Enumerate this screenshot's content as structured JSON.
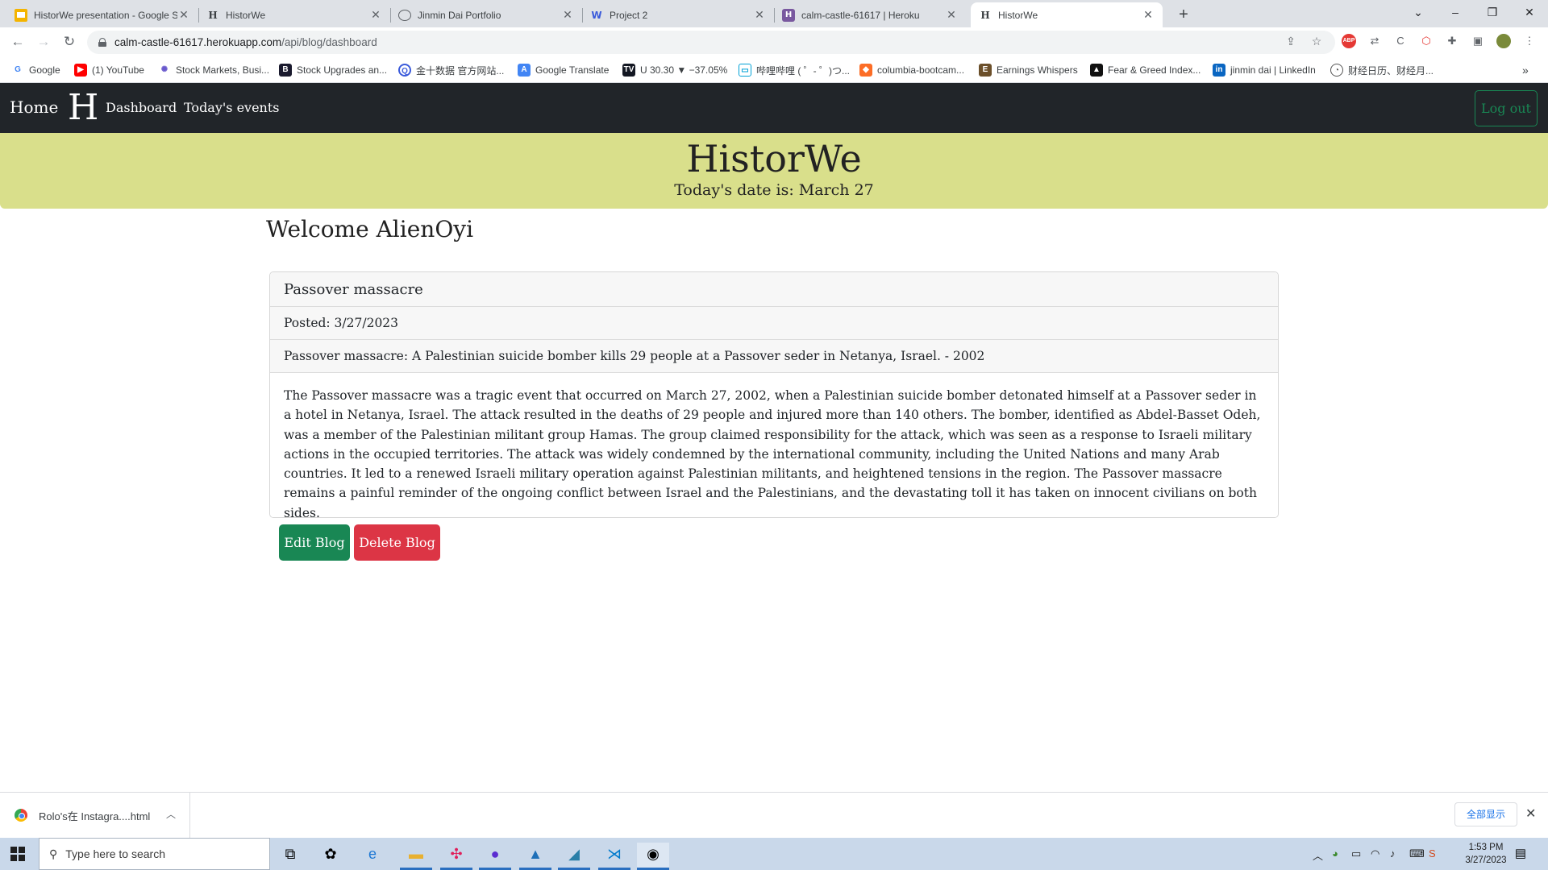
{
  "browser": {
    "tabs": [
      {
        "title": "HistorWe presentation - Google S",
        "icon": "slides-icon",
        "color": "#f4b400",
        "active": false
      },
      {
        "title": "HistorWe",
        "icon": "historwe-favicon",
        "active": false
      },
      {
        "title": "Jinmin Dai Portfolio",
        "icon": "globe-icon",
        "active": false
      },
      {
        "title": "Project 2",
        "icon": "project-icon",
        "active": false
      },
      {
        "title": "calm-castle-61617 | Heroku",
        "icon": "heroku-icon",
        "color": "#79589f",
        "active": false
      },
      {
        "title": "HistorWe",
        "icon": "historwe-favicon",
        "active": true
      }
    ],
    "url_host": "calm-castle-61617.herokuapp.com",
    "url_path": "/api/blog/dashboard",
    "bookmarks": [
      {
        "label": "Google",
        "icon": "google-icon"
      },
      {
        "label": "(1) YouTube",
        "icon": "youtube-icon"
      },
      {
        "label": "Stock Markets, Busi...",
        "icon": "nbc-icon"
      },
      {
        "label": "Stock Upgrades an...",
        "icon": "b-icon"
      },
      {
        "label": "金十数据 官方网站...",
        "icon": "jin10-icon"
      },
      {
        "label": "Google Translate",
        "icon": "translate-icon"
      },
      {
        "label": "U 30.30 ▼ −37.05%",
        "icon": "tradingview-icon"
      },
      {
        "label": "哔哩哔哩 ( ゜- ゜)つ...",
        "icon": "bilibili-icon"
      },
      {
        "label": "columbia-bootcam...",
        "icon": "gitlab-icon"
      },
      {
        "label": "Earnings Whispers",
        "icon": "earnings-icon"
      },
      {
        "label": "Fear & Greed Index...",
        "icon": "cnn-icon"
      },
      {
        "label": "jinmin dai | LinkedIn",
        "icon": "linkedin-icon"
      },
      {
        "label": "财经日历、财经月...",
        "icon": "calendar-icon"
      }
    ]
  },
  "site": {
    "nav": {
      "home": "Home",
      "logo_letter": "H",
      "dashboard": "Dashboard",
      "events": "Today's events",
      "logout": "Log out"
    },
    "banner": {
      "title": "HistorWe",
      "date": "Today's date is: March 27"
    },
    "welcome": "Welcome AlienOyi",
    "blog": {
      "title": "Passover massacre",
      "posted": "Posted: 3/27/2023",
      "summary": "Passover massacre: A Palestinian suicide bomber kills 29 people at a Passover seder in Netanya, Israel. - 2002",
      "body": "The Passover massacre was a tragic event that occurred on March 27, 2002, when a Palestinian suicide bomber detonated himself at a Passover seder in a hotel in Netanya, Israel. The attack resulted in the deaths of 29 people and injured more than 140 others. The bomber, identified as Abdel-Basset Odeh, was a member of the Palestinian militant group Hamas. The group claimed responsibility for the attack, which was seen as a response to Israeli military actions in the occupied territories. The attack was widely condemned by the international community, including the United Nations and many Arab countries. It led to a renewed Israeli military operation against Palestinian militants, and heightened tensions in the region. The Passover massacre remains a painful reminder of the ongoing conflict between Israel and the Palestinians, and the devastating toll it has taken on innocent civilians on both sides."
    },
    "buttons": {
      "edit": "Edit Blog",
      "delete": "Delete Blog"
    },
    "colors": {
      "navbar": "#212529",
      "banner": "#d9df8b",
      "edit": "#198754",
      "delete": "#dc3545"
    }
  },
  "downloads": {
    "file": "Rolo's在 Instagra....html",
    "show_all": "全部显示"
  },
  "taskbar": {
    "search_placeholder": "Type here to search",
    "time": "1:53 PM",
    "date": "3/27/2023"
  }
}
